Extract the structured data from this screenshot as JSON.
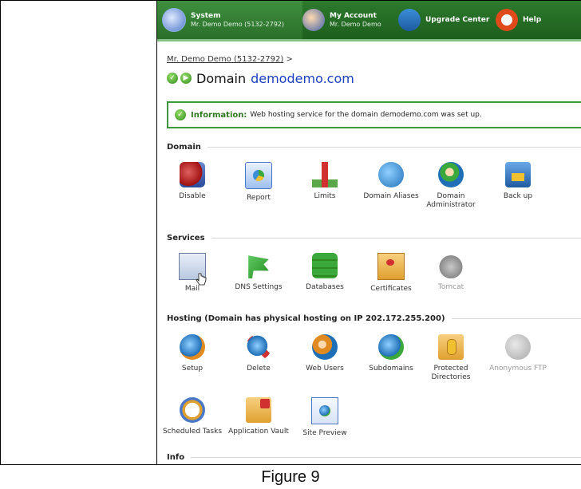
{
  "topbar": {
    "system": {
      "title": "System",
      "subtitle": "Mr. Demo Demo (5132-2792)"
    },
    "account": {
      "title": "My Account",
      "subtitle": "Mr. Demo Demo"
    },
    "upgrade": {
      "title": "Upgrade Center"
    },
    "help": {
      "title": "Help"
    }
  },
  "breadcrumb": {
    "link": "Mr. Demo Demo (5132-2792)",
    "sep": ">"
  },
  "page": {
    "label": "Domain",
    "domain": "demodemo.com"
  },
  "info": {
    "label": "Information:",
    "message": "Web hosting service for the domain demodemo.com was set up."
  },
  "sections": {
    "domain": "Domain",
    "services": "Services",
    "hosting": "Hosting (Domain has physical hosting on IP 202.172.255.200)",
    "info": "Info"
  },
  "domain_icons": {
    "disable": "Disable",
    "report": "Report",
    "limits": "Limits",
    "aliases": "Domain Aliases",
    "admin": "Domain Administrator",
    "backup": "Back up"
  },
  "service_icons": {
    "mail": "Mail",
    "dns": "DNS Settings",
    "databases": "Databases",
    "certificates": "Certificates",
    "tomcat": "Tomcat"
  },
  "hosting_icons": {
    "setup": "Setup",
    "delete": "Delete",
    "webusers": "Web Users",
    "subdomains": "Subdomains",
    "protected": "Protected Directories",
    "anonftp": "Anonymous FTP",
    "scheduled": "Scheduled Tasks",
    "vault": "Application Vault",
    "preview": "Site Preview"
  },
  "caption": "Figure 9"
}
